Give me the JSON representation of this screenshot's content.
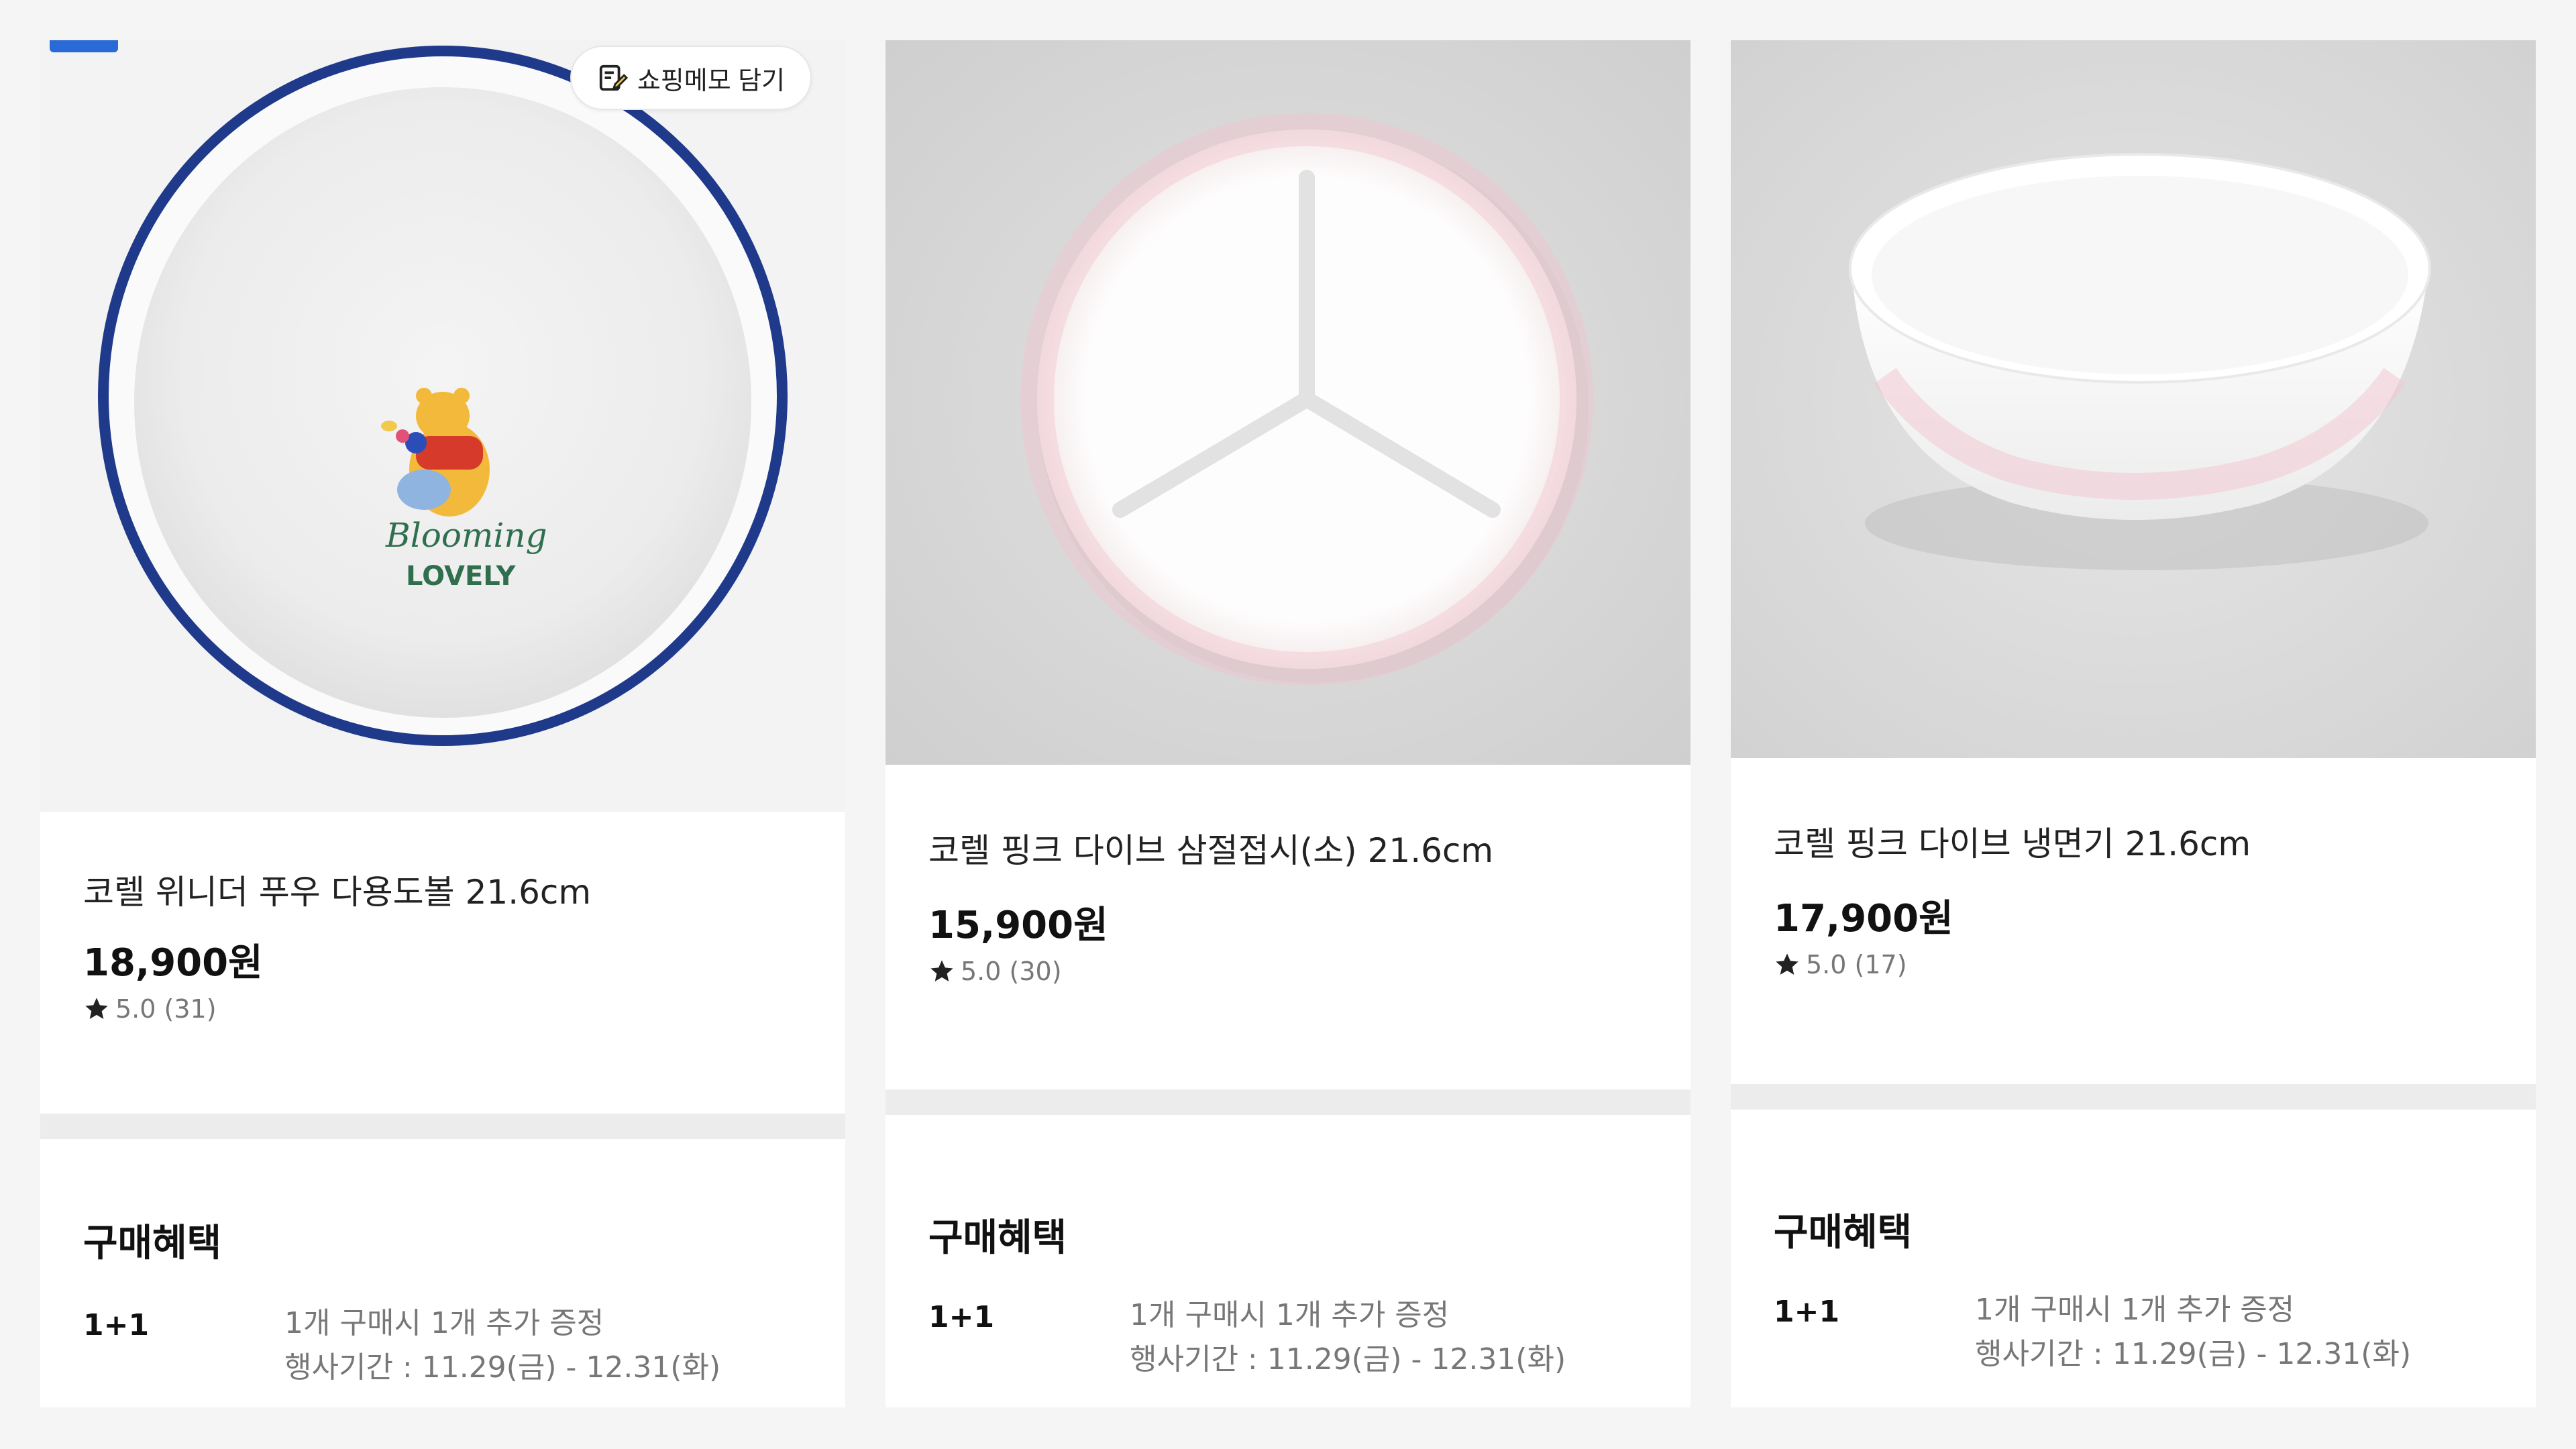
{
  "products": [
    {
      "name": "코렐 위니더 푸우 다용도볼 21.6cm",
      "price": "18,900원",
      "rating": "5.0 (31)",
      "memo_button": "쇼핑메모 담기",
      "plate_art": {
        "line1": "Blooming",
        "line2": "LOVELY"
      },
      "benefit_title": "구매혜택",
      "benefit_tag": "1+1",
      "benefit_desc": "1개 구매시 1개 추가 증정",
      "benefit_period": "행사기간 : 11.29(금) - 12.31(화)"
    },
    {
      "name": "코렐 핑크 다이브 삼절접시(소) 21.6cm",
      "price": "15,900원",
      "rating": "5.0 (30)",
      "benefit_title": "구매혜택",
      "benefit_tag": "1+1",
      "benefit_desc": "1개 구매시 1개 추가 증정",
      "benefit_period": "행사기간 : 11.29(금) - 12.31(화)"
    },
    {
      "name": "코렐 핑크 다이브 냉면기 21.6cm",
      "price": "17,900원",
      "rating": "5.0 (17)",
      "benefit_title": "구매혜택",
      "benefit_tag": "1+1",
      "benefit_desc": "1개 구매시 1개 추가 증정",
      "benefit_period": "행사기간 : 11.29(금) - 12.31(화)"
    }
  ],
  "icons": {
    "star": "star-icon",
    "memo": "memo-pencil-icon"
  },
  "colors": {
    "plate_rim": "#1f3a8a",
    "badge": "#2a6ad6",
    "price_text": "#111111",
    "muted_text": "#777777"
  }
}
